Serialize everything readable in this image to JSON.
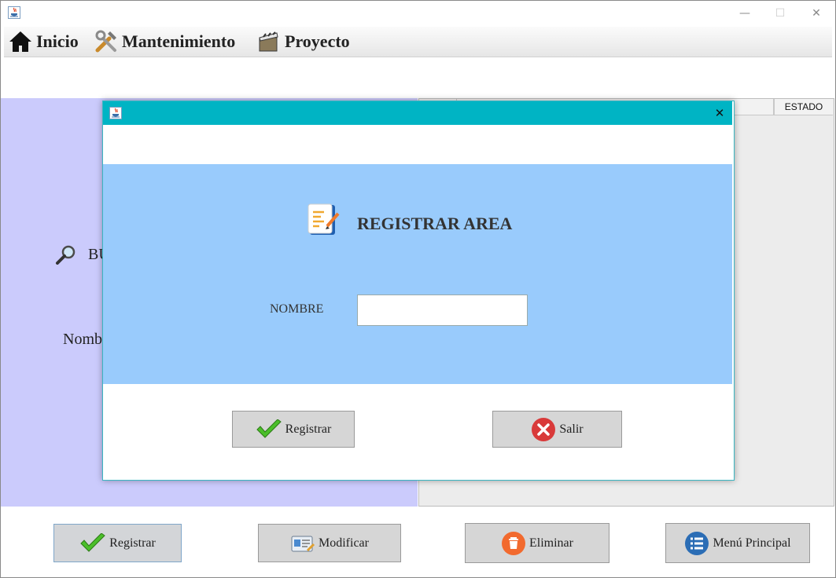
{
  "window": {
    "controls": {
      "minimize": "—",
      "maximize": "☐",
      "close": "✕"
    }
  },
  "menu": [
    {
      "label": "Inicio",
      "icon": "home-icon"
    },
    {
      "label": "Mantenimiento",
      "icon": "tools-icon"
    },
    {
      "label": "Proyecto",
      "icon": "clapperboard-icon"
    }
  ],
  "left_panel": {
    "search_label": "BU",
    "nombre_label": "Nomb"
  },
  "table": {
    "columns": [
      "",
      "",
      "ESTADO"
    ]
  },
  "bottom_buttons": {
    "registrar": "Registrar",
    "modificar": "Modificar",
    "eliminar": "Eliminar",
    "menu_principal": "Menú Principal"
  },
  "dialog": {
    "close": "✕",
    "heading": "REGISTRAR AREA",
    "nombre_label": "NOMBRE",
    "nombre_value": "",
    "registrar": "Registrar",
    "salir": "Salir"
  },
  "colors": {
    "dialog_titlebar": "#00b4c4",
    "dialog_form_bg": "#99cbfc",
    "left_panel_bg": "#cbcbfc"
  }
}
